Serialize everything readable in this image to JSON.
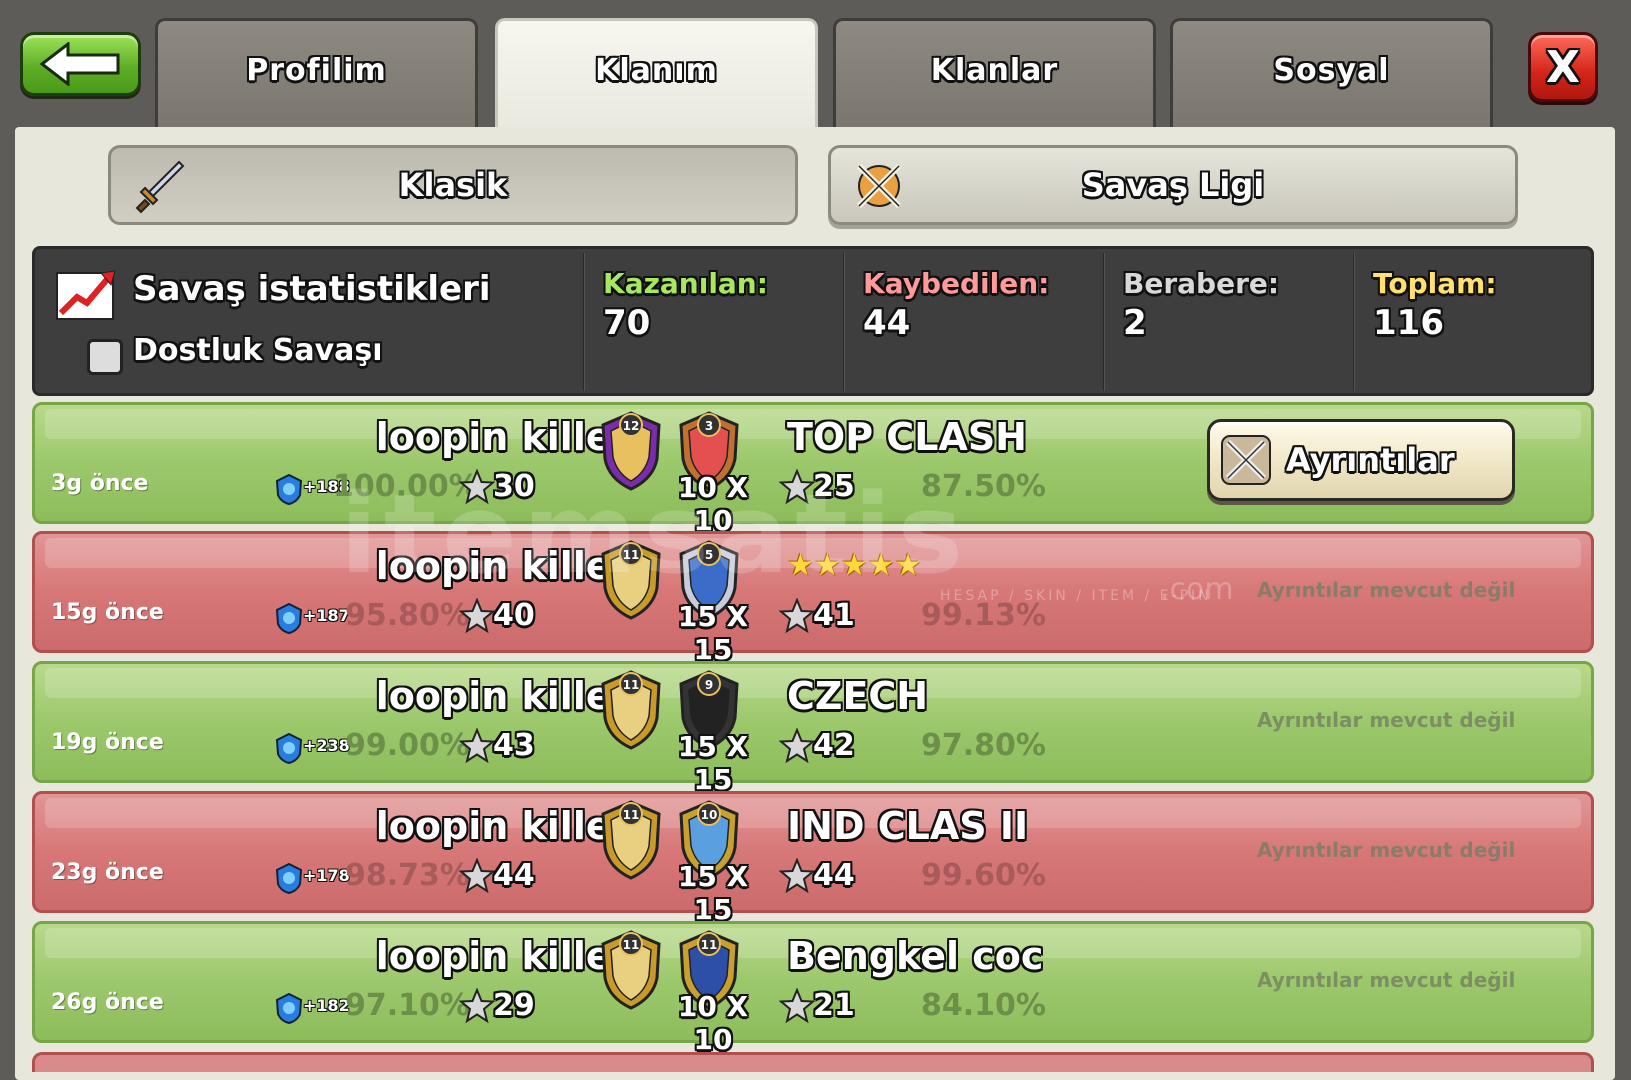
{
  "tabs": [
    {
      "label": "Profilim",
      "active": false
    },
    {
      "label": "Klanım",
      "active": true
    },
    {
      "label": "Klanlar",
      "active": false
    },
    {
      "label": "Sosyal",
      "active": false
    }
  ],
  "close_label": "X",
  "subtabs": {
    "classic": "Klasik",
    "war_league": "Savaş Ligi"
  },
  "stats": {
    "title": "Savaş istatistikleri",
    "friendly_label": "Dostluk Savaşı",
    "friendly_checked": false,
    "won_label": "Kazanılan:",
    "won": "70",
    "lost_label": "Kaybedilen:",
    "lost": "44",
    "draw_label": "Berabere:",
    "draw": "2",
    "total_label": "Toplam:",
    "total": "116",
    "colors": {
      "won": "#a8e860",
      "lost": "#ff9a9a",
      "draw": "#d8d8d8",
      "total": "#ffe070"
    }
  },
  "details_label": "Ayrıntılar",
  "no_details_label": "Ayrıntılar mevcut değil",
  "wars": [
    {
      "result": "win",
      "ago": "3g önce",
      "clan": "loopin killers",
      "clan_level": "12",
      "opponent": "TOP CLASH",
      "opponent_level": "3",
      "xp": "+188",
      "pct": "100.00%",
      "stars": "30",
      "size": "10 X 10",
      "opp_stars": "25",
      "opp_pct": "87.50%",
      "details": true
    },
    {
      "result": "loss",
      "ago": "15g önce",
      "clan": "loopin killers",
      "clan_level": "11",
      "opponent": "★★★★★",
      "opponent_level": "5",
      "xp": "+187",
      "pct": "95.80%",
      "stars": "40",
      "size": "15 X 15",
      "opp_stars": "41",
      "opp_pct": "99.13%",
      "details": false
    },
    {
      "result": "win",
      "ago": "19g önce",
      "clan": "loopin killers",
      "clan_level": "11",
      "opponent": "CZECH",
      "opponent_level": "9",
      "xp": "+238",
      "pct": "99.00%",
      "stars": "43",
      "size": "15 X 15",
      "opp_stars": "42",
      "opp_pct": "97.80%",
      "details": false
    },
    {
      "result": "loss",
      "ago": "23g önce",
      "clan": "loopin killers",
      "clan_level": "11",
      "opponent": "IND CLAS II",
      "opponent_level": "10",
      "xp": "+178",
      "pct": "98.73%",
      "stars": "44",
      "size": "15 X 15",
      "opp_stars": "44",
      "opp_pct": "99.60%",
      "details": false
    },
    {
      "result": "win",
      "ago": "26g önce",
      "clan": "loopin killers",
      "clan_level": "11",
      "opponent": "Bengkel coc",
      "opponent_level": "11",
      "xp": "+182",
      "pct": "97.10%",
      "stars": "29",
      "size": "10 X 10",
      "opp_stars": "21",
      "opp_pct": "84.10%",
      "details": false
    }
  ],
  "watermark": {
    "brand": "itemsatis",
    "tagline": "HESAP / SKIN / ITEM / E-PIN",
    "suffix": ".com"
  }
}
